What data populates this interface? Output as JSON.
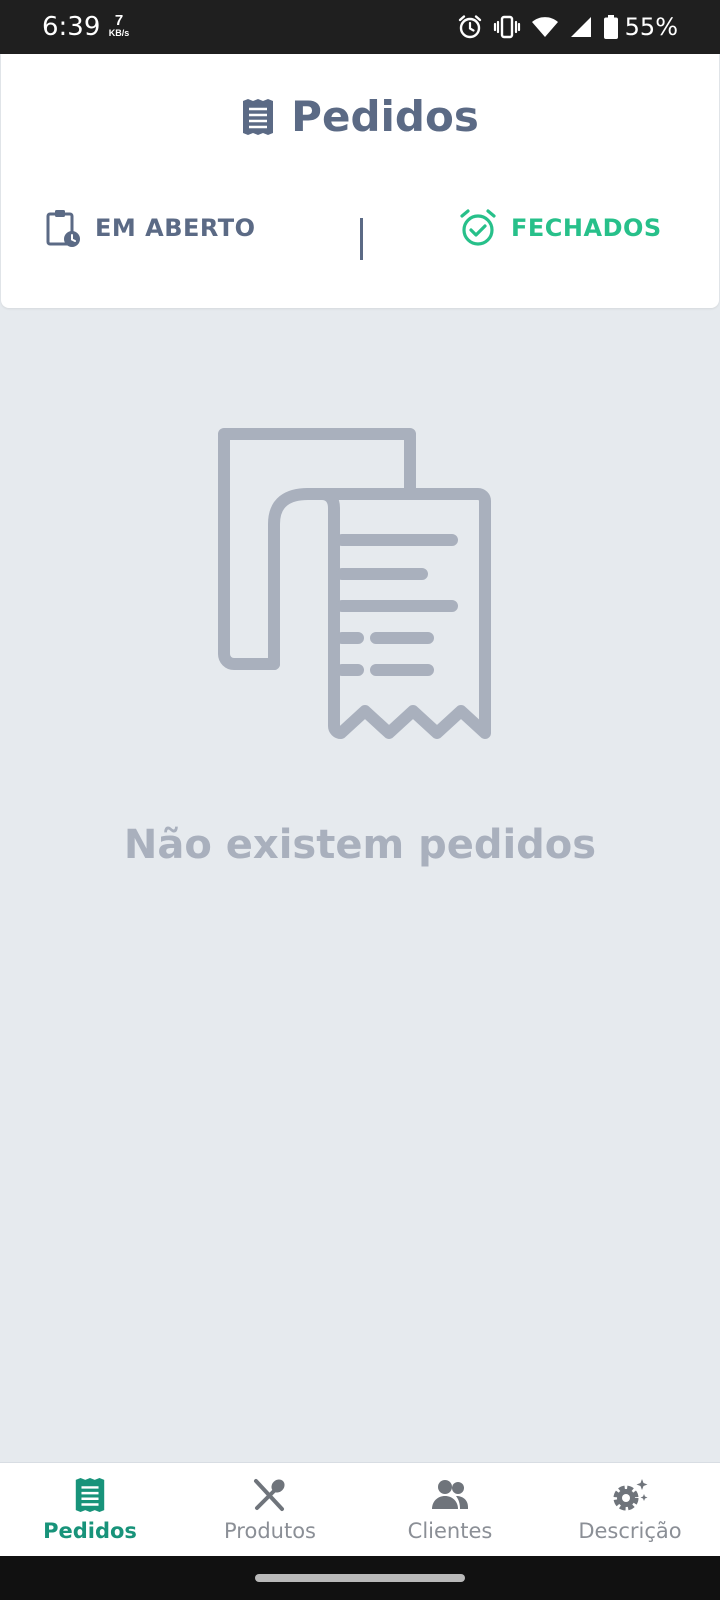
{
  "status_bar": {
    "time": "6:39",
    "speed_value": "7",
    "speed_unit": "KB/s",
    "battery": "55%",
    "icons": [
      "alarm-icon",
      "vibrate-icon",
      "wifi-icon",
      "signal-icon",
      "battery-icon"
    ]
  },
  "header": {
    "title": "Pedidos",
    "title_icon": "receipt-icon",
    "tabs": [
      {
        "label": "EM ABERTO",
        "icon": "clipboard-clock-icon",
        "active": false
      },
      {
        "label": "FECHADOS",
        "icon": "alarm-check-icon",
        "active": true
      }
    ]
  },
  "empty_state": {
    "icon": "receipts-illustration",
    "message": "Não existem pedidos"
  },
  "bottom_nav": {
    "items": [
      {
        "label": "Pedidos",
        "icon": "receipt-icon",
        "active": true
      },
      {
        "label": "Produtos",
        "icon": "utensils-icon",
        "active": false
      },
      {
        "label": "Clientes",
        "icon": "users-icon",
        "active": false
      },
      {
        "label": "Descrição",
        "icon": "gear-sparkle-icon",
        "active": false
      }
    ]
  },
  "colors": {
    "header_text": "#5b6a85",
    "active_tab": "#27c08a",
    "active_nav": "#18937a",
    "inactive_nav": "#8b8f96",
    "background": "#e6eaee",
    "illustration": "#a9b0bd"
  }
}
